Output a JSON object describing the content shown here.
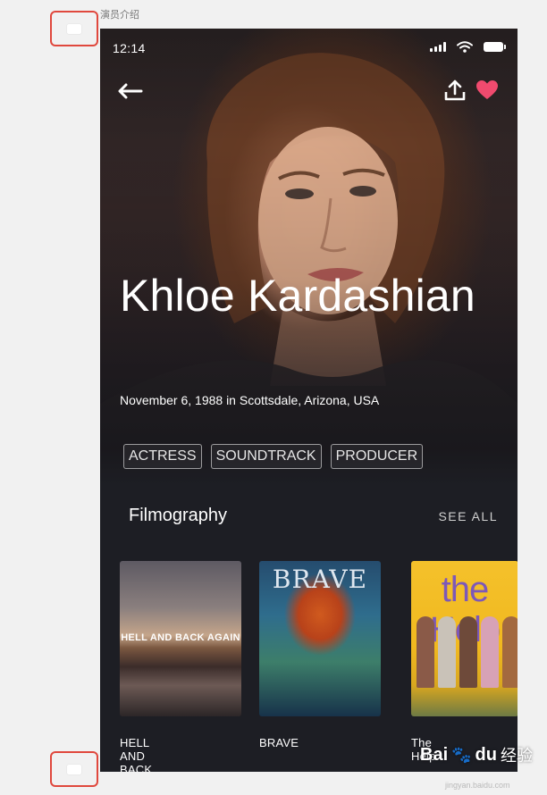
{
  "artboard": {
    "label": "演员介绍"
  },
  "status_bar": {
    "time": "12:14"
  },
  "actor": {
    "name": "Khloe Kardashian",
    "birth": "November 6, 1988 in Scottsdale, Arizona, USA",
    "tags": [
      "ACTRESS",
      "SOUNDTRACK",
      "PRODUCER"
    ]
  },
  "filmography": {
    "title": "Filmography",
    "see_all": "SEE ALL",
    "films": [
      {
        "title": "HELL AND BACK",
        "poster_text": "HELL AND BACK AGAIN"
      },
      {
        "title": "BRAVE",
        "poster_text": "BRAVE"
      },
      {
        "title": "The Help",
        "poster_text": "the Help"
      }
    ]
  },
  "watermark": {
    "brand": "Bai",
    "brand2": "du",
    "sub": "经验",
    "url": "jingyan.baidu.com"
  },
  "colors": {
    "background": "#f1f1f1",
    "screen": "#1d1e24",
    "heart": "#f04a6e",
    "annotation": "#e0483d"
  }
}
